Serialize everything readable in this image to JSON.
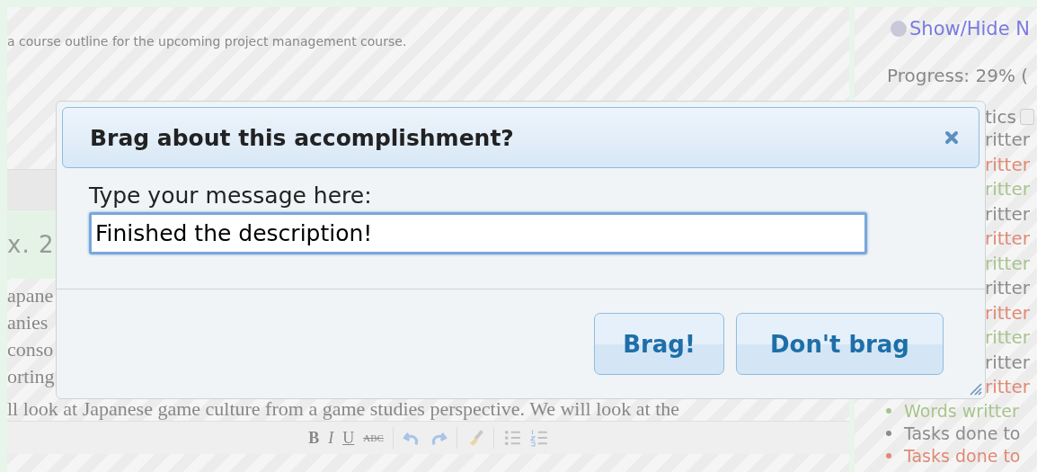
{
  "editor": {
    "intro": "a course outline for the upcoming project management course.",
    "section_heading": "x. 2",
    "body_lines": [
      "apane",
      "anies",
      "conso",
      "orting",
      "ll look at Japanese game culture from a game studies perspective. We will look at the"
    ],
    "toolbar": [
      {
        "kind": "bold",
        "label": "B"
      },
      {
        "kind": "italic",
        "label": "I"
      },
      {
        "kind": "underline",
        "label": "U"
      },
      {
        "kind": "strike",
        "label": "ABC"
      },
      {
        "kind": "sep"
      },
      {
        "kind": "undo"
      },
      {
        "kind": "redo"
      },
      {
        "kind": "sep"
      },
      {
        "kind": "brush"
      },
      {
        "kind": "sep"
      },
      {
        "kind": "bullets"
      },
      {
        "kind": "numbers"
      }
    ]
  },
  "sidebar": {
    "toggle_link": "Show/Hide N",
    "progress": "Progress: 29% (",
    "stats_heading": "tics",
    "stats": [
      {
        "text": "ritter",
        "color": "#8c8c8c"
      },
      {
        "text": "ritter",
        "color": "#e08a74"
      },
      {
        "text": "ritter",
        "color": "#a8c48c"
      },
      {
        "text": "ritter",
        "color": "#8c8c8c"
      },
      {
        "text": "ritter",
        "color": "#e08a74"
      },
      {
        "text": "ritter",
        "color": "#a8c48c"
      },
      {
        "text": "ritter",
        "color": "#8c8c8c"
      },
      {
        "text": "ritter",
        "color": "#e08a74"
      },
      {
        "text": "ritter",
        "color": "#a8c48c"
      },
      {
        "text": "ritter",
        "color": "#8c8c8c"
      },
      {
        "text": "ritter",
        "color": "#e08a74"
      }
    ],
    "bullets": [
      {
        "text": "Words writter",
        "color": "#a8c48c"
      },
      {
        "text": "Tasks done to",
        "color": "#8c8c8c"
      },
      {
        "text": "Tasks done to",
        "color": "#e08a74"
      }
    ]
  },
  "dialog": {
    "title": "Brag about this accomplishment?",
    "label": "Type your message here:",
    "message": "Finished the description!",
    "buttons": [
      "Brag!",
      "Don't brag"
    ]
  }
}
